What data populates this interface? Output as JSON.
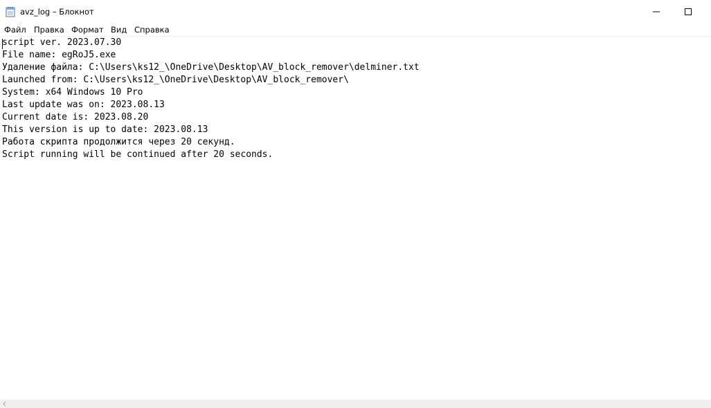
{
  "window": {
    "title": "avz_log – Блокнот",
    "minimize_icon": "minimize-icon",
    "maximize_icon": "maximize-icon"
  },
  "menu": {
    "items": [
      {
        "label": "Файл"
      },
      {
        "label": "Правка"
      },
      {
        "label": "Формат"
      },
      {
        "label": "Вид"
      },
      {
        "label": "Справка"
      }
    ]
  },
  "editor": {
    "lines": [
      "script ver. 2023.07.30",
      "File name: egRoJ5.exe",
      "Удаление файла: C:\\Users\\ks12_\\OneDrive\\Desktop\\AV_block_remover\\delminer.txt",
      "Launched from: C:\\Users\\ks12_\\OneDrive\\Desktop\\AV_block_remover\\",
      "System: x64 Windows 10 Pro",
      "Last update was on: 2023.08.13",
      "Current date is: 2023.08.20",
      "This version is up to date: 2023.08.13",
      "Работа скрипта продолжится через 20 секунд.",
      "Script running will be continued after 20 seconds."
    ]
  },
  "colors": {
    "background": "#ffffff",
    "text": "#000000",
    "scrollbar": "#f0f0f0"
  }
}
